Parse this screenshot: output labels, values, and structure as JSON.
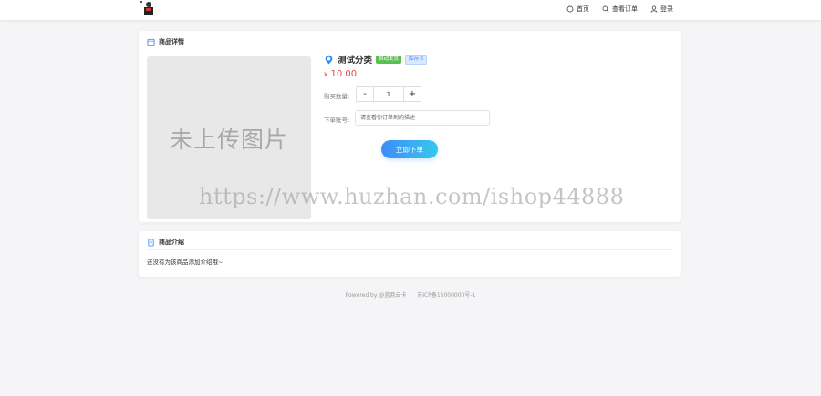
{
  "header": {
    "nav": {
      "home": "首页",
      "orders": "查看订单",
      "login": "登录"
    }
  },
  "detail": {
    "section_title": "商品详情",
    "image_placeholder": "未上传图片",
    "goods_name": "测试分类",
    "badge_auto": "自动发货",
    "badge_stock": "库存:5",
    "price_symbol": "¥",
    "price": "10.00",
    "quantity_label": "购买数量:",
    "quantity_minus": "-",
    "quantity_value": "1",
    "quantity_plus": "+",
    "remark_label": "下单账号:",
    "remark_placeholder": "请查看你订单到的描述",
    "buy_button": "立即下单"
  },
  "intro": {
    "section_title": "商品介绍",
    "text": "还没有为该商品添加介绍哦~"
  },
  "footer": {
    "powered": "Powered by @蓝商云卡",
    "icp": "苏ICP备15000000号-1"
  },
  "watermark": "https://www.huzhan.com/ishop44888",
  "colors": {
    "price": "#e8474a",
    "badge_green": "#5bbf4d",
    "badge_blue": "#4a8af4",
    "button_start": "#3f8cf5",
    "button_end": "#35c8ee"
  }
}
